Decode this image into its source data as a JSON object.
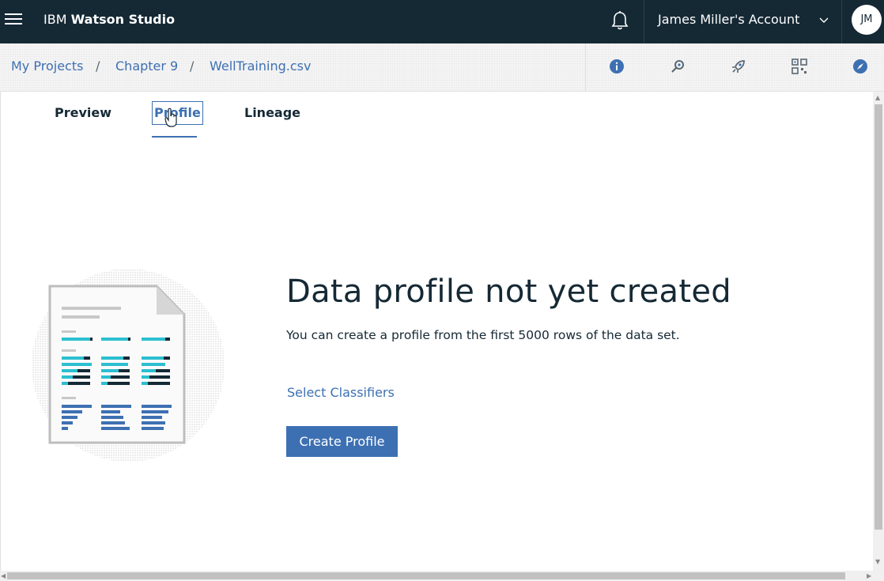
{
  "topbar": {
    "brand_prefix": "IBM",
    "brand_name": "Watson Studio",
    "account": "James Miller's Account",
    "avatar_initials": "JM"
  },
  "breadcrumb": {
    "items": [
      "My Projects",
      "Chapter 9",
      "WellTraining.csv"
    ],
    "separator": "/"
  },
  "toolbar": {
    "icons": [
      "info-icon",
      "wrench-icon",
      "rocket-icon",
      "qr-icon",
      "compass-icon"
    ]
  },
  "tabs": [
    {
      "label": "Preview",
      "active": false
    },
    {
      "label": "Profile",
      "active": true
    },
    {
      "label": "Lineage",
      "active": false
    }
  ],
  "empty_state": {
    "heading": "Data profile not yet created",
    "description": "You can create a profile from the first 5000 rows of the data set.",
    "link": "Select Classifiers",
    "button": "Create Profile"
  },
  "colors": {
    "topbar_bg": "#152935",
    "accent": "#3d70b2",
    "teal": "#2bbfd0"
  }
}
